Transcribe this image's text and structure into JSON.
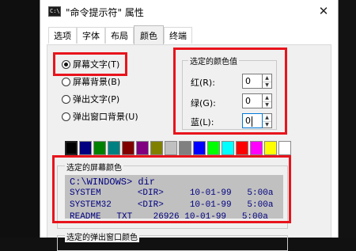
{
  "window": {
    "icon_text": "C:\\",
    "title": "\"命令提示符\" 属性",
    "close_glyph": "✕"
  },
  "tabs": [
    {
      "label": "选项"
    },
    {
      "label": "字体"
    },
    {
      "label": "布局"
    },
    {
      "label": "颜色",
      "active": true
    },
    {
      "label": "终端"
    }
  ],
  "target_options": [
    {
      "label": "屏幕文字(T)",
      "checked": true
    },
    {
      "label": "屏幕背景(B)",
      "checked": false
    },
    {
      "label": "弹出文字(P)",
      "checked": false
    },
    {
      "label": "弹出窗口背景(U)",
      "checked": false
    }
  ],
  "selected_color": {
    "group_title": "选定的颜色值",
    "red_label": "红(R):",
    "red_value": "0",
    "green_label": "绿(G):",
    "green_value": "0",
    "blue_label": "蓝(L):",
    "blue_value": "0"
  },
  "palette": [
    "#000000",
    "#000080",
    "#008000",
    "#008080",
    "#800000",
    "#800080",
    "#808000",
    "#c0c0c0",
    "#808080",
    "#0000ff",
    "#00ff00",
    "#00ffff",
    "#ff0000",
    "#ff00ff",
    "#ffff00",
    "#ffffff"
  ],
  "screen_preview": {
    "group_title": "选定的屏幕颜色",
    "lines": [
      "C:\\WINDOWS> dir",
      "SYSTEM       <DIR>     10-01-99   5:00a",
      "SYSTEM32     <DIR>     10-01-99   5:00a",
      "README   TXT    26926 10-01-99   5:00a"
    ],
    "text_color": "#000080",
    "background": "#c0c0c0"
  },
  "popup_preview": {
    "group_title": "选定的弹出窗口颜色"
  },
  "highlight_color": "#e8141c"
}
